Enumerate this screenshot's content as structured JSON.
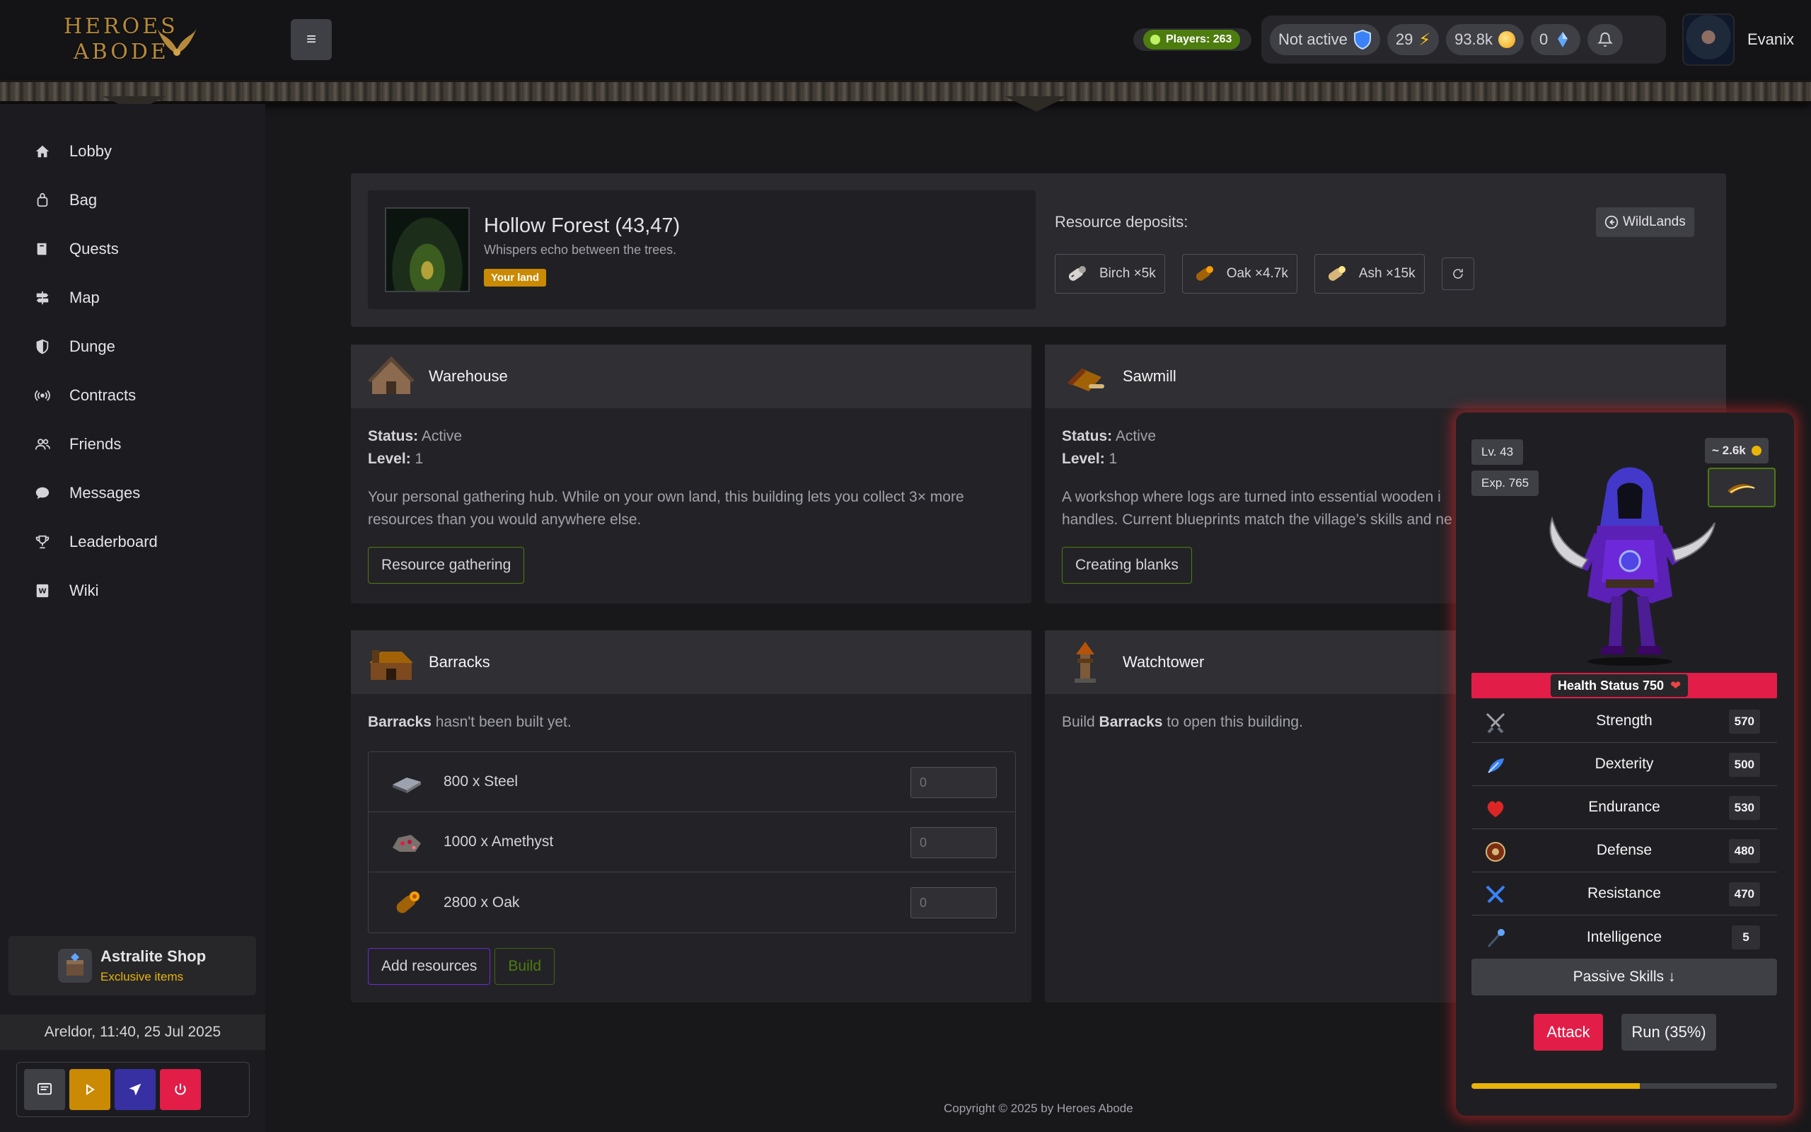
{
  "header": {
    "logo_line1": "HEROES",
    "logo_line2": "ABODE",
    "menu_icon": "hamburger-icon",
    "players": "Players: 263",
    "status": "Not active",
    "energy": "29",
    "gold": "93.8k",
    "crystals": "0",
    "username": "Evanix"
  },
  "sidebar": {
    "items": [
      {
        "label": "Lobby",
        "icon": "home-icon"
      },
      {
        "label": "Bag",
        "icon": "bag-icon"
      },
      {
        "label": "Quests",
        "icon": "book-icon"
      },
      {
        "label": "Map",
        "icon": "signpost-icon"
      },
      {
        "label": "Dunge",
        "icon": "shield-icon"
      },
      {
        "label": "Contracts",
        "icon": "broadcast-icon"
      },
      {
        "label": "Friends",
        "icon": "users-icon"
      },
      {
        "label": "Messages",
        "icon": "chat-icon"
      },
      {
        "label": "Leaderboard",
        "icon": "trophy-icon"
      },
      {
        "label": "Wiki",
        "icon": "wiki-icon"
      }
    ],
    "shop_title": "Astralite Shop",
    "shop_subtitle": "Exclusive items",
    "server_time": "Areldor, 11:40, 25 Jul 2025"
  },
  "land": {
    "title": "Hollow Forest (43,47)",
    "subtitle": "Whispers echo between the trees.",
    "badge": "Your land",
    "deposits_label": "Resource deposits:",
    "wildlands": "WildLands",
    "deposits": [
      {
        "label": "Birch ×5k",
        "icon": "birch-log-icon"
      },
      {
        "label": "Oak ×4.7k",
        "icon": "oak-log-icon"
      },
      {
        "label": "Ash ×15k",
        "icon": "ash-log-icon"
      }
    ]
  },
  "buildings": {
    "warehouse": {
      "name": "Warehouse",
      "status_label": "Status:",
      "status": "Active",
      "level_label": "Level:",
      "level": "1",
      "desc": "Your personal gathering hub. While on your own land, this building lets you collect 3× more resources than you would anywhere else.",
      "button": "Resource gathering"
    },
    "sawmill": {
      "name": "Sawmill",
      "status_label": "Status:",
      "status": "Active",
      "level_label": "Level:",
      "level": "1",
      "desc": "A workshop where logs are turned into essential wooden i",
      "desc2": "handles. Current blueprints match the village’s skills and ne",
      "button": "Creating blanks"
    },
    "barracks": {
      "name": "Barracks",
      "not_built_name": "Barracks",
      "not_built_text": " hasn't been built yet.",
      "requirements": [
        {
          "label": "800 x Steel",
          "icon": "steel-ingot-icon",
          "value": "0"
        },
        {
          "label": "1000 x Amethyst",
          "icon": "amethyst-ore-icon",
          "value": "0"
        },
        {
          "label": "2800 x Oak",
          "icon": "oak-log-icon",
          "value": "0"
        }
      ],
      "add_button": "Add resources",
      "build_button": "Build"
    },
    "watchtower": {
      "name": "Watchtower",
      "text_pre": "Build ",
      "text_bold": "Barracks",
      "text_post": " to open this building."
    }
  },
  "character": {
    "level": "Lv. 43",
    "exp": "Exp. 765",
    "gold": "~ 2.6k",
    "health": "Health Status 750",
    "attributes": [
      {
        "name": "Strength",
        "value": "570",
        "icon": "crossed-swords-icon"
      },
      {
        "name": "Dexterity",
        "value": "500",
        "icon": "feather-icon"
      },
      {
        "name": "Endurance",
        "value": "530",
        "icon": "heart-icon"
      },
      {
        "name": "Defense",
        "value": "480",
        "icon": "round-shield-icon"
      },
      {
        "name": "Resistance",
        "value": "470",
        "icon": "crossed-blades-icon"
      },
      {
        "name": "Intelligence",
        "value": "5",
        "icon": "magic-staff-icon"
      }
    ],
    "passive": "Passive Skills ↓",
    "attack": "Attack",
    "run": "Run (35%)",
    "progress": 0.55
  },
  "footer": "Copyright © 2025 by Heroes Abode",
  "colors": {
    "accent_green": "#4d7c0f",
    "danger": "#e11d48",
    "gold": "#eab308",
    "bg": "#18181b"
  }
}
